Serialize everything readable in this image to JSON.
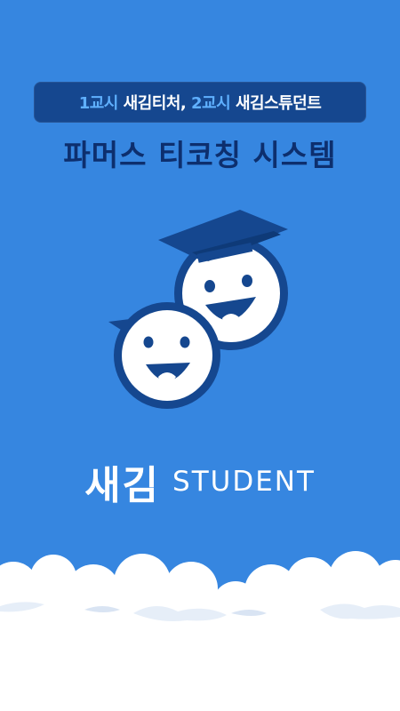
{
  "banner": {
    "period1": "1교시",
    "app1": "새김티처,",
    "period2": "2교시",
    "app2": "새김스튜던트"
  },
  "title": "파머스 티코칭 시스템",
  "brand": {
    "korean": "새김",
    "english": "STUDENT"
  },
  "colors": {
    "background": "#3686e0",
    "banner_bg": "#15478f",
    "banner_highlight": "#5fb0ff",
    "title": "#0d2f6e",
    "logo_dark": "#15478f",
    "white": "#ffffff"
  },
  "icons": {
    "logo": "two-smiling-faces-with-graduation-cap-icon",
    "footer": "clouds-decoration"
  }
}
